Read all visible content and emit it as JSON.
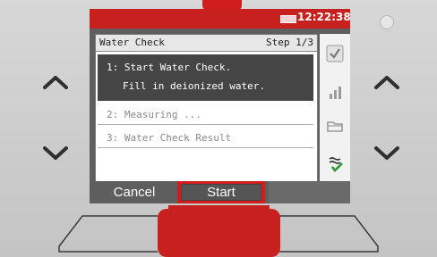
{
  "status_bar": {
    "battery_icon": "battery-icon",
    "time": "12:22:38"
  },
  "panel": {
    "title": "Water Check",
    "step_indicator": "Step 1/3",
    "steps": [
      {
        "line1": "1: Start Water Check.",
        "line2": "Fill in deionized water.",
        "state": "active"
      },
      {
        "label": "2: Measuring ...",
        "state": "inactive"
      },
      {
        "label": "3: Water Check Result",
        "state": "inactive"
      }
    ]
  },
  "sidebar": {
    "icons": [
      "checkmark-icon",
      "chart-icon",
      "folder-icon",
      "status-check-icon"
    ]
  },
  "softkeys": {
    "left": "Cancel",
    "middle": "Start",
    "right": ""
  },
  "colors": {
    "accent_red": "#c8201e",
    "panel_bg": "#ffffff",
    "active_row": "#454545"
  }
}
